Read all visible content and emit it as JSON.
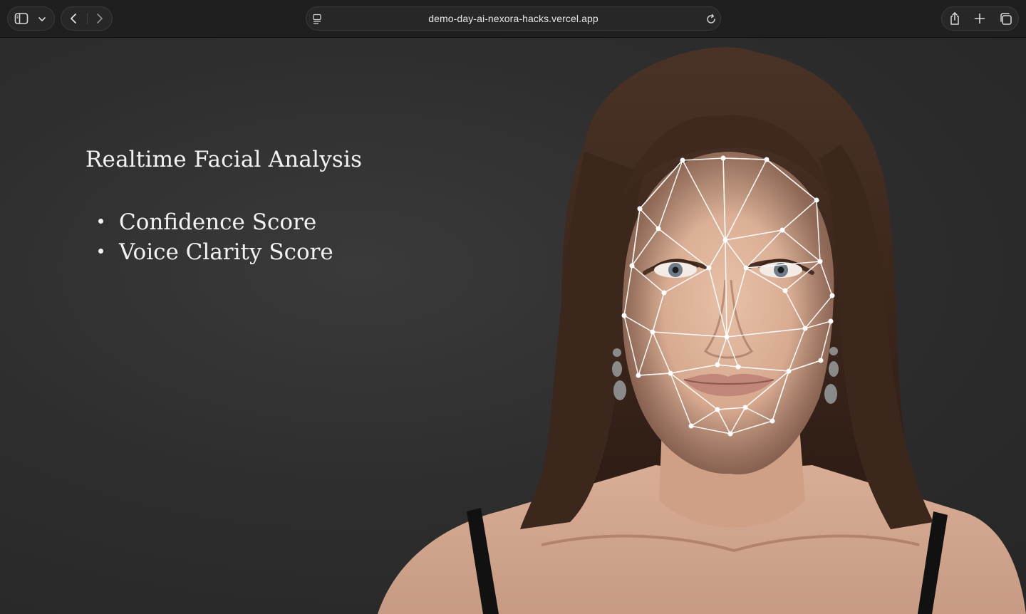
{
  "browser": {
    "url": "demo-day-ai-nexora-hacks.vercel.app",
    "icons": {
      "sidebar": "sidebar-toggle-icon",
      "sidebar_menu": "chevron-down-icon",
      "back": "chevron-left-icon",
      "forward": "chevron-right-icon",
      "page_menu": "page-menu-icon",
      "reload": "reload-icon",
      "share": "share-icon",
      "new_tab": "plus-icon",
      "tabs": "tab-overview-icon"
    }
  },
  "slide": {
    "title": "Realtime Facial Analysis",
    "bullets": [
      "Confidence Score",
      "Voice Clarity Score"
    ]
  },
  "colors": {
    "chrome_bg": "#1f1f1f",
    "page_bg": "#2e2e2e",
    "text": "#f2f2f2",
    "mesh": "#ffffff"
  }
}
